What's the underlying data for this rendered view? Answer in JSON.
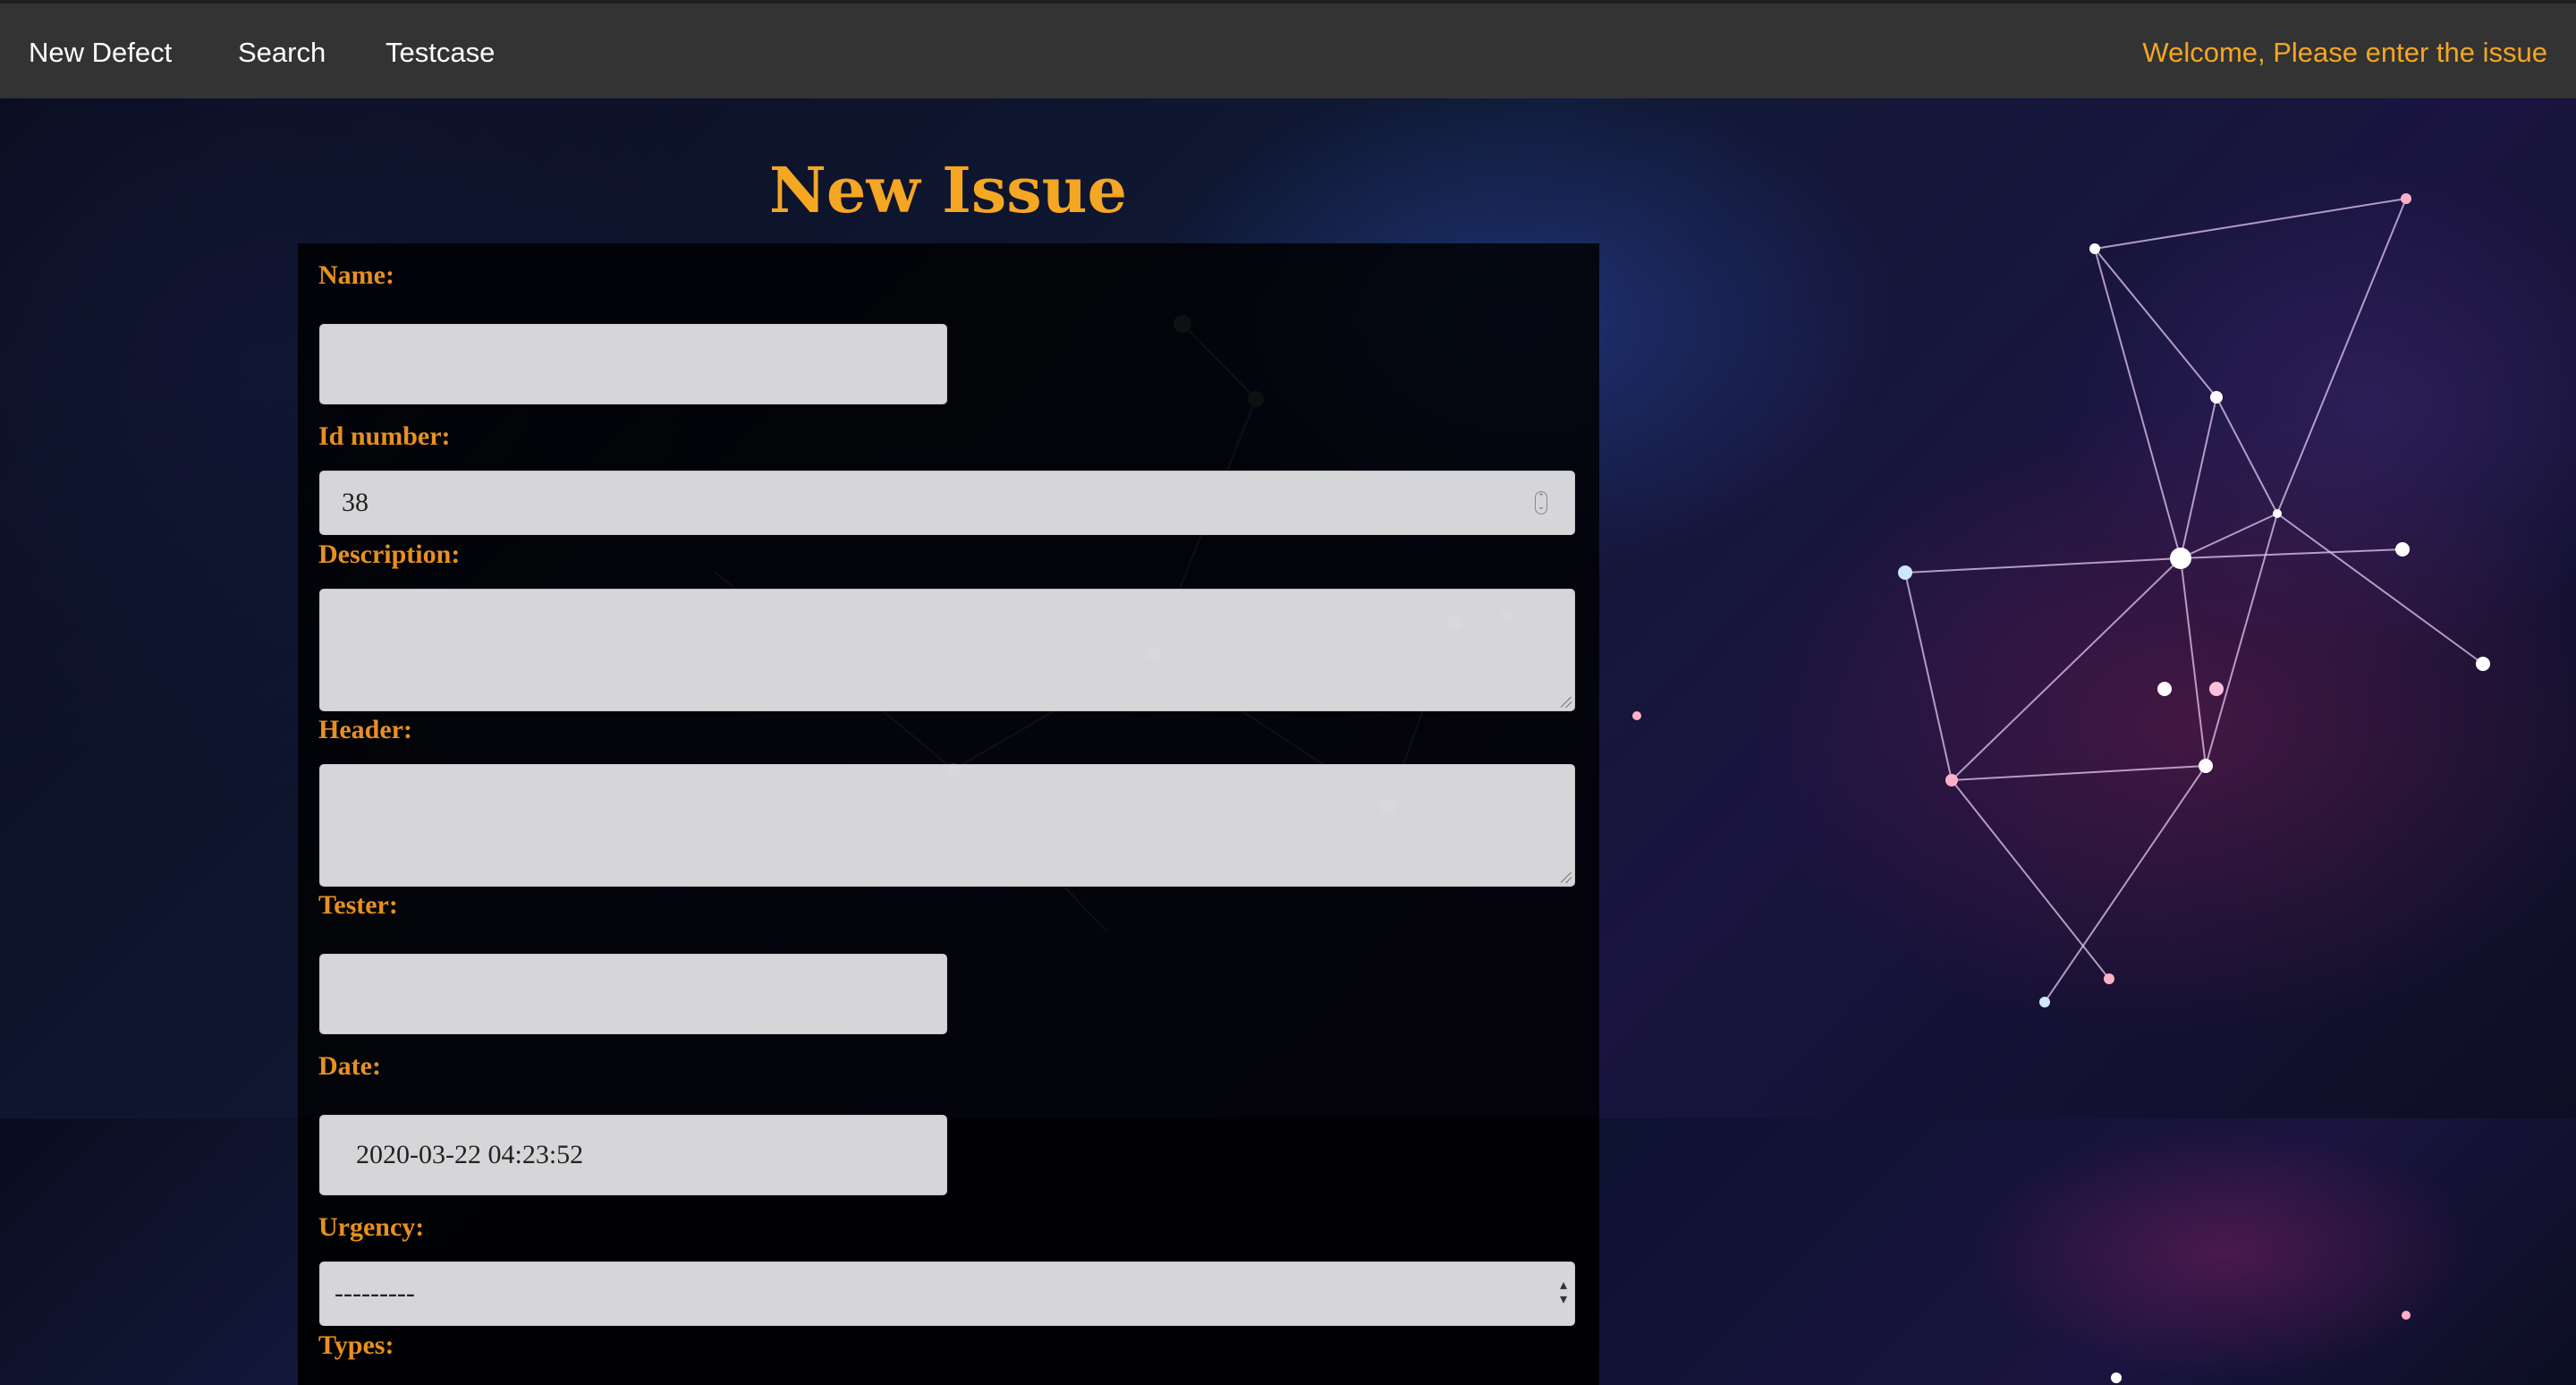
{
  "navbar": {
    "links": [
      {
        "label": "New Defect"
      },
      {
        "label": "Search"
      },
      {
        "label": "Testcase"
      }
    ],
    "welcome": "Welcome, Please enter the issue"
  },
  "page": {
    "title": "New Issue"
  },
  "form": {
    "name": {
      "label": "Name:",
      "value": ""
    },
    "id_number": {
      "label": "Id number:",
      "value": "38"
    },
    "description": {
      "label": "Description:",
      "value": ""
    },
    "header": {
      "label": "Header:",
      "value": ""
    },
    "tester": {
      "label": "Tester:",
      "value": ""
    },
    "date": {
      "label": "Date:",
      "value": "2020-03-22 04:23:52"
    },
    "urgency": {
      "label": "Urgency:",
      "selected": "---------"
    },
    "types": {
      "label": "Types:"
    }
  },
  "colors": {
    "navbar_bg": "#333333",
    "accent": "#f5a623",
    "label": "#e8901f",
    "field_bg": "#e8e8ec"
  }
}
